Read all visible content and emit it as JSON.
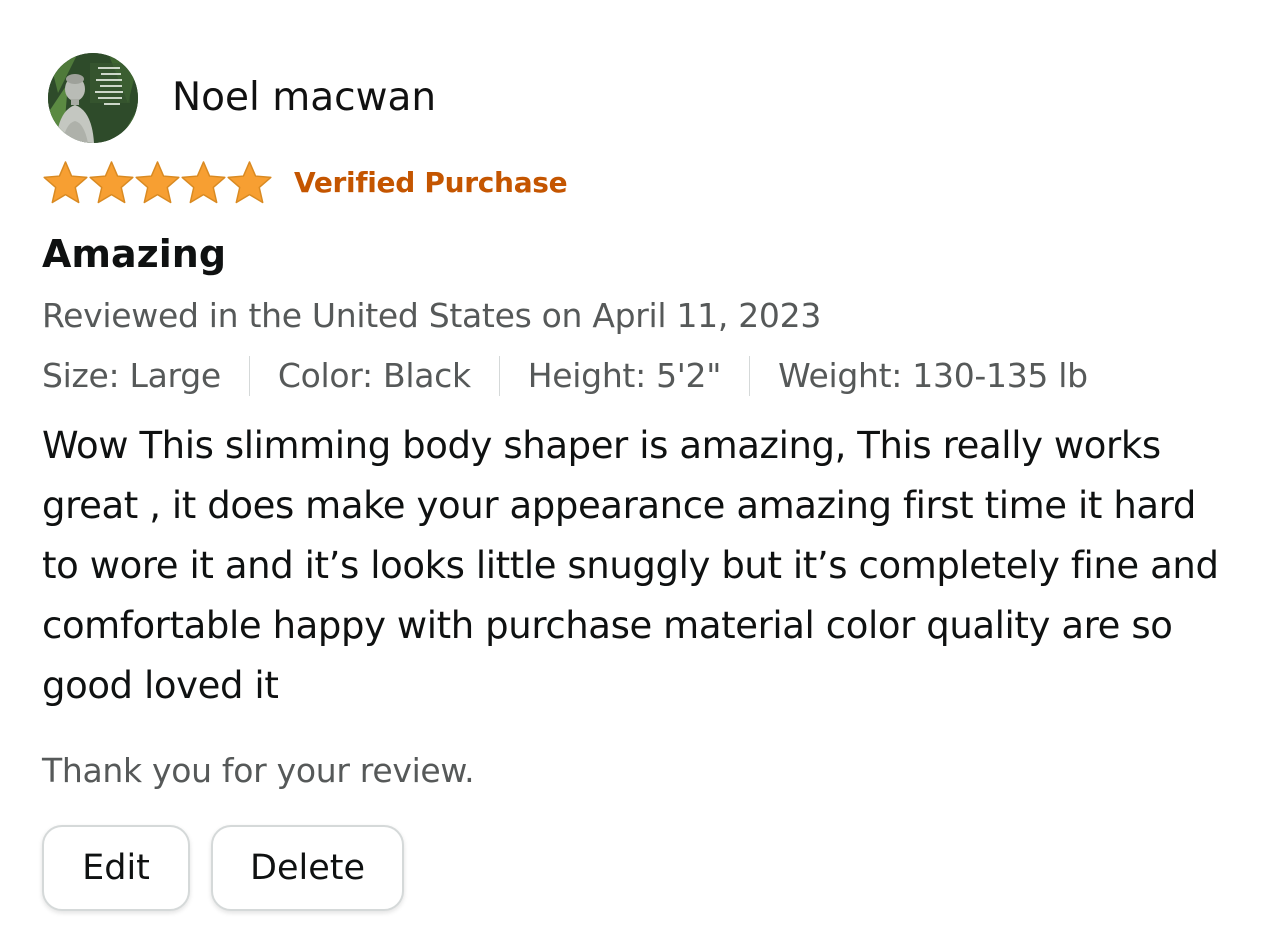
{
  "reviewer": {
    "name": "Noel macwan",
    "avatar_icon": "buddha-avatar"
  },
  "rating": {
    "stars": 5,
    "max_stars": 5,
    "star_color": "#f79f32"
  },
  "badge": {
    "label": "Verified Purchase",
    "color": "#c45500"
  },
  "review": {
    "title": "Amazing",
    "date_line": "Reviewed in the United States on April 11, 2023",
    "variants": [
      "Size: Large",
      "Color: Black",
      "Height: 5'2\"",
      "Weight: 130-135 lb"
    ],
    "body": "Wow This slimming body shaper is amazing, This really works great , it does make your appearance amazing first time it hard to wore it and it’s looks little snuggly but it’s completely fine and comfortable happy with purchase material color quality are so good loved it"
  },
  "thanks_message": "Thank you for your review.",
  "actions": {
    "edit_label": "Edit",
    "delete_label": "Delete"
  }
}
